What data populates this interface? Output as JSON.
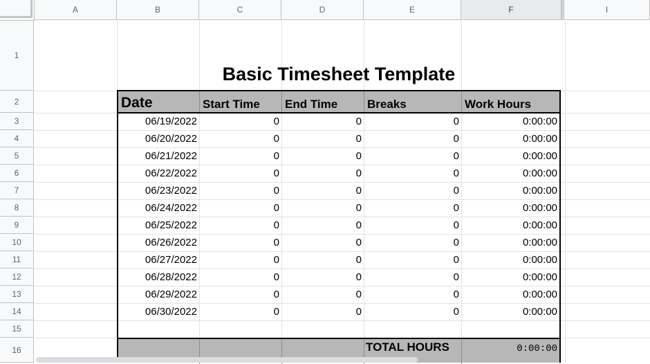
{
  "columns": [
    "A",
    "B",
    "C",
    "D",
    "E",
    "F",
    "I"
  ],
  "rows": [
    "1",
    "2",
    "3",
    "4",
    "5",
    "6",
    "7",
    "8",
    "9",
    "10",
    "11",
    "12",
    "13",
    "14",
    "15",
    "16"
  ],
  "sheet": {
    "title": "Basic Timesheet Template",
    "headers": [
      "Date",
      "Start Time",
      "End Time",
      "Breaks",
      "Work Hours"
    ],
    "entries": [
      {
        "date": "06/19/2022",
        "start": "0",
        "end": "0",
        "breaks": "0",
        "hours": "0:00:00"
      },
      {
        "date": "06/20/2022",
        "start": "0",
        "end": "0",
        "breaks": "0",
        "hours": "0:00:00"
      },
      {
        "date": "06/21/2022",
        "start": "0",
        "end": "0",
        "breaks": "0",
        "hours": "0:00:00"
      },
      {
        "date": "06/22/2022",
        "start": "0",
        "end": "0",
        "breaks": "0",
        "hours": "0:00:00"
      },
      {
        "date": "06/23/2022",
        "start": "0",
        "end": "0",
        "breaks": "0",
        "hours": "0:00:00"
      },
      {
        "date": "06/24/2022",
        "start": "0",
        "end": "0",
        "breaks": "0",
        "hours": "0:00:00"
      },
      {
        "date": "06/25/2022",
        "start": "0",
        "end": "0",
        "breaks": "0",
        "hours": "0:00:00"
      },
      {
        "date": "06/26/2022",
        "start": "0",
        "end": "0",
        "breaks": "0",
        "hours": "0:00:00"
      },
      {
        "date": "06/27/2022",
        "start": "0",
        "end": "0",
        "breaks": "0",
        "hours": "0:00:00"
      },
      {
        "date": "06/28/2022",
        "start": "0",
        "end": "0",
        "breaks": "0",
        "hours": "0:00:00"
      },
      {
        "date": "06/29/2022",
        "start": "0",
        "end": "0",
        "breaks": "0",
        "hours": "0:00:00"
      },
      {
        "date": "06/30/2022",
        "start": "0",
        "end": "0",
        "breaks": "0",
        "hours": "0:00:00"
      }
    ],
    "total_label": "TOTAL HOURS",
    "total_value": "0:00:00"
  },
  "colors": {
    "header_fill": "#b7b7b7",
    "border": "#000000",
    "grid": "#e2e2e2"
  }
}
